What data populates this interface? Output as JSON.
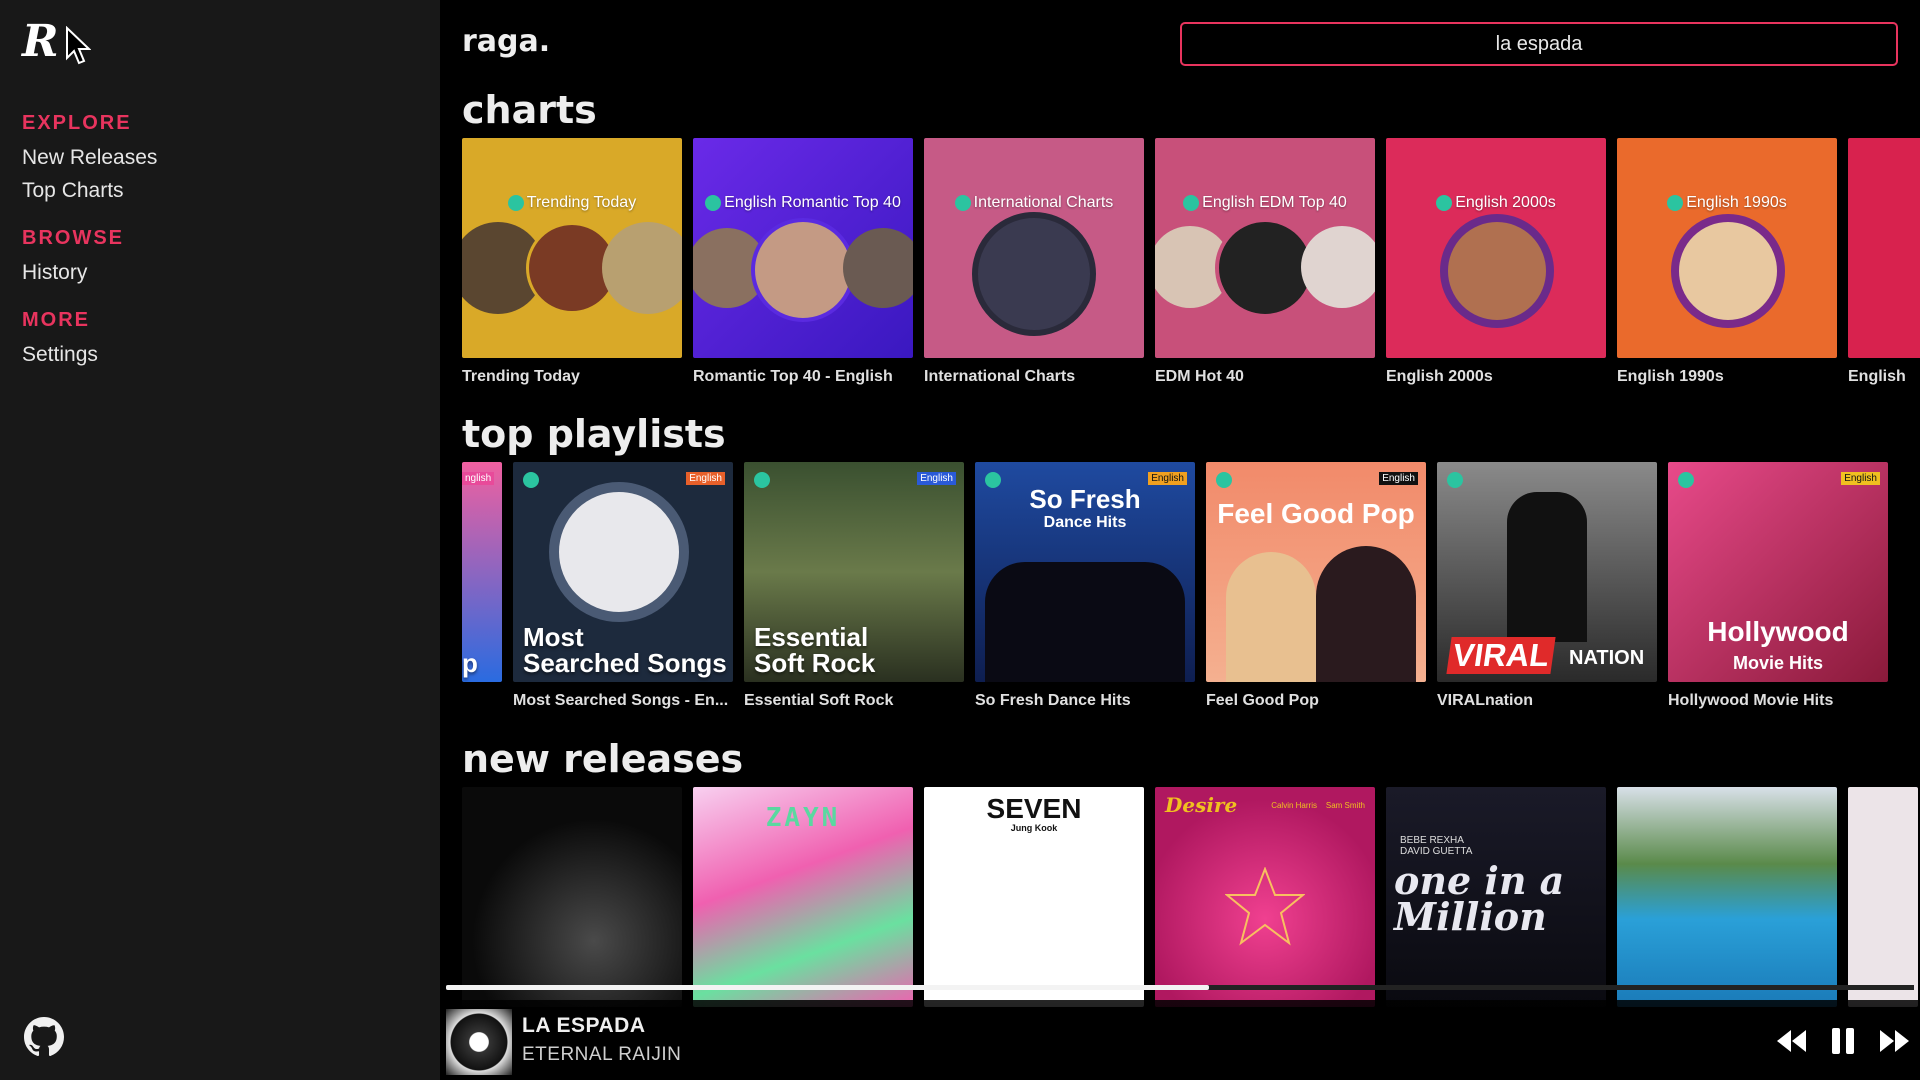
{
  "sidebar": {
    "logo_letter": "R",
    "sections": [
      {
        "head": "EXPLORE",
        "items": [
          "New Releases",
          "Top Charts"
        ]
      },
      {
        "head": "BROWSE",
        "items": [
          "History"
        ]
      },
      {
        "head": "MORE",
        "items": [
          "Settings"
        ]
      }
    ]
  },
  "header": {
    "brand": "raga.",
    "search_value": "la espada"
  },
  "sections": {
    "charts_title": "charts",
    "playlists_title": "top playlists",
    "releases_title": "new releases"
  },
  "charts": [
    {
      "label": "Trending Today",
      "caption": "Trending Today",
      "bg": "#d9a928"
    },
    {
      "label": "English Romantic Top 40",
      "caption": "Romantic Top 40 - English",
      "bg": "#4a23d8"
    },
    {
      "label": "International Charts",
      "caption": "International Charts",
      "bg": "#c65a86"
    },
    {
      "label": "English EDM Top 40",
      "caption": "EDM Hot 40",
      "bg": "#c8507a"
    },
    {
      "label": "English 2000s",
      "caption": "English 2000s",
      "bg": "#dc2b5a"
    },
    {
      "label": "English 1990s",
      "caption": "English 1990s",
      "bg": "#ea6a2c"
    },
    {
      "label": "",
      "caption": "English",
      "bg": "#d8224e"
    }
  ],
  "playlists": [
    {
      "title": "p",
      "caption": "",
      "tag": "nglish",
      "bg": "#2a6be0"
    },
    {
      "title": "Most\nSearched Songs",
      "caption": "Most Searched Songs - En...",
      "tag": "English",
      "bg": "#1d2a3d"
    },
    {
      "title": "Essential\nSoft Rock",
      "caption": "Essential Soft Rock",
      "tag": "English",
      "bg": "#4f6a3a"
    },
    {
      "title": "So Fresh",
      "subtitle": "Dance Hits",
      "caption": "So Fresh Dance Hits",
      "tag": "English",
      "bg": "#1a3a80"
    },
    {
      "title": "Feel Good Pop",
      "caption": "Feel Good Pop",
      "tag": "English",
      "bg": "#f08a70"
    },
    {
      "title": "VIRAL",
      "subtitle": "NATION",
      "caption": "VIRALnation",
      "tag": "",
      "bg": "#3a3a3a"
    },
    {
      "title": "Hollywood",
      "subtitle": "Movie Hits",
      "caption": "Hollywood Movie Hits",
      "tag": "English",
      "bg": "#c83a6a"
    }
  ],
  "releases": [
    {
      "text": "",
      "bg": "#0a0a0a"
    },
    {
      "text": "ZAYN",
      "bg": "#f05ab0"
    },
    {
      "text": "SEVEN",
      "sub": "Jung Kook",
      "bg": "#ffffff"
    },
    {
      "text": "Desire",
      "sub": "Calvin Harris    Sam Smith",
      "bg": "#d81d6a"
    },
    {
      "text": "one in a Million",
      "sub": "BEBE REXHA\nDAVID GUETTA",
      "bg": "#141420"
    },
    {
      "text": "",
      "bg": "#2f8fc8"
    },
    {
      "text": "",
      "bg": "#e8e0e4"
    }
  ],
  "now_playing": {
    "title": "LA ESPADA",
    "artist": "ETERNAL RAIJIN",
    "progress": 0.52
  },
  "colors": {
    "accent": "#e8345e",
    "sidebar_bg": "#181818",
    "main_bg": "#000000"
  }
}
